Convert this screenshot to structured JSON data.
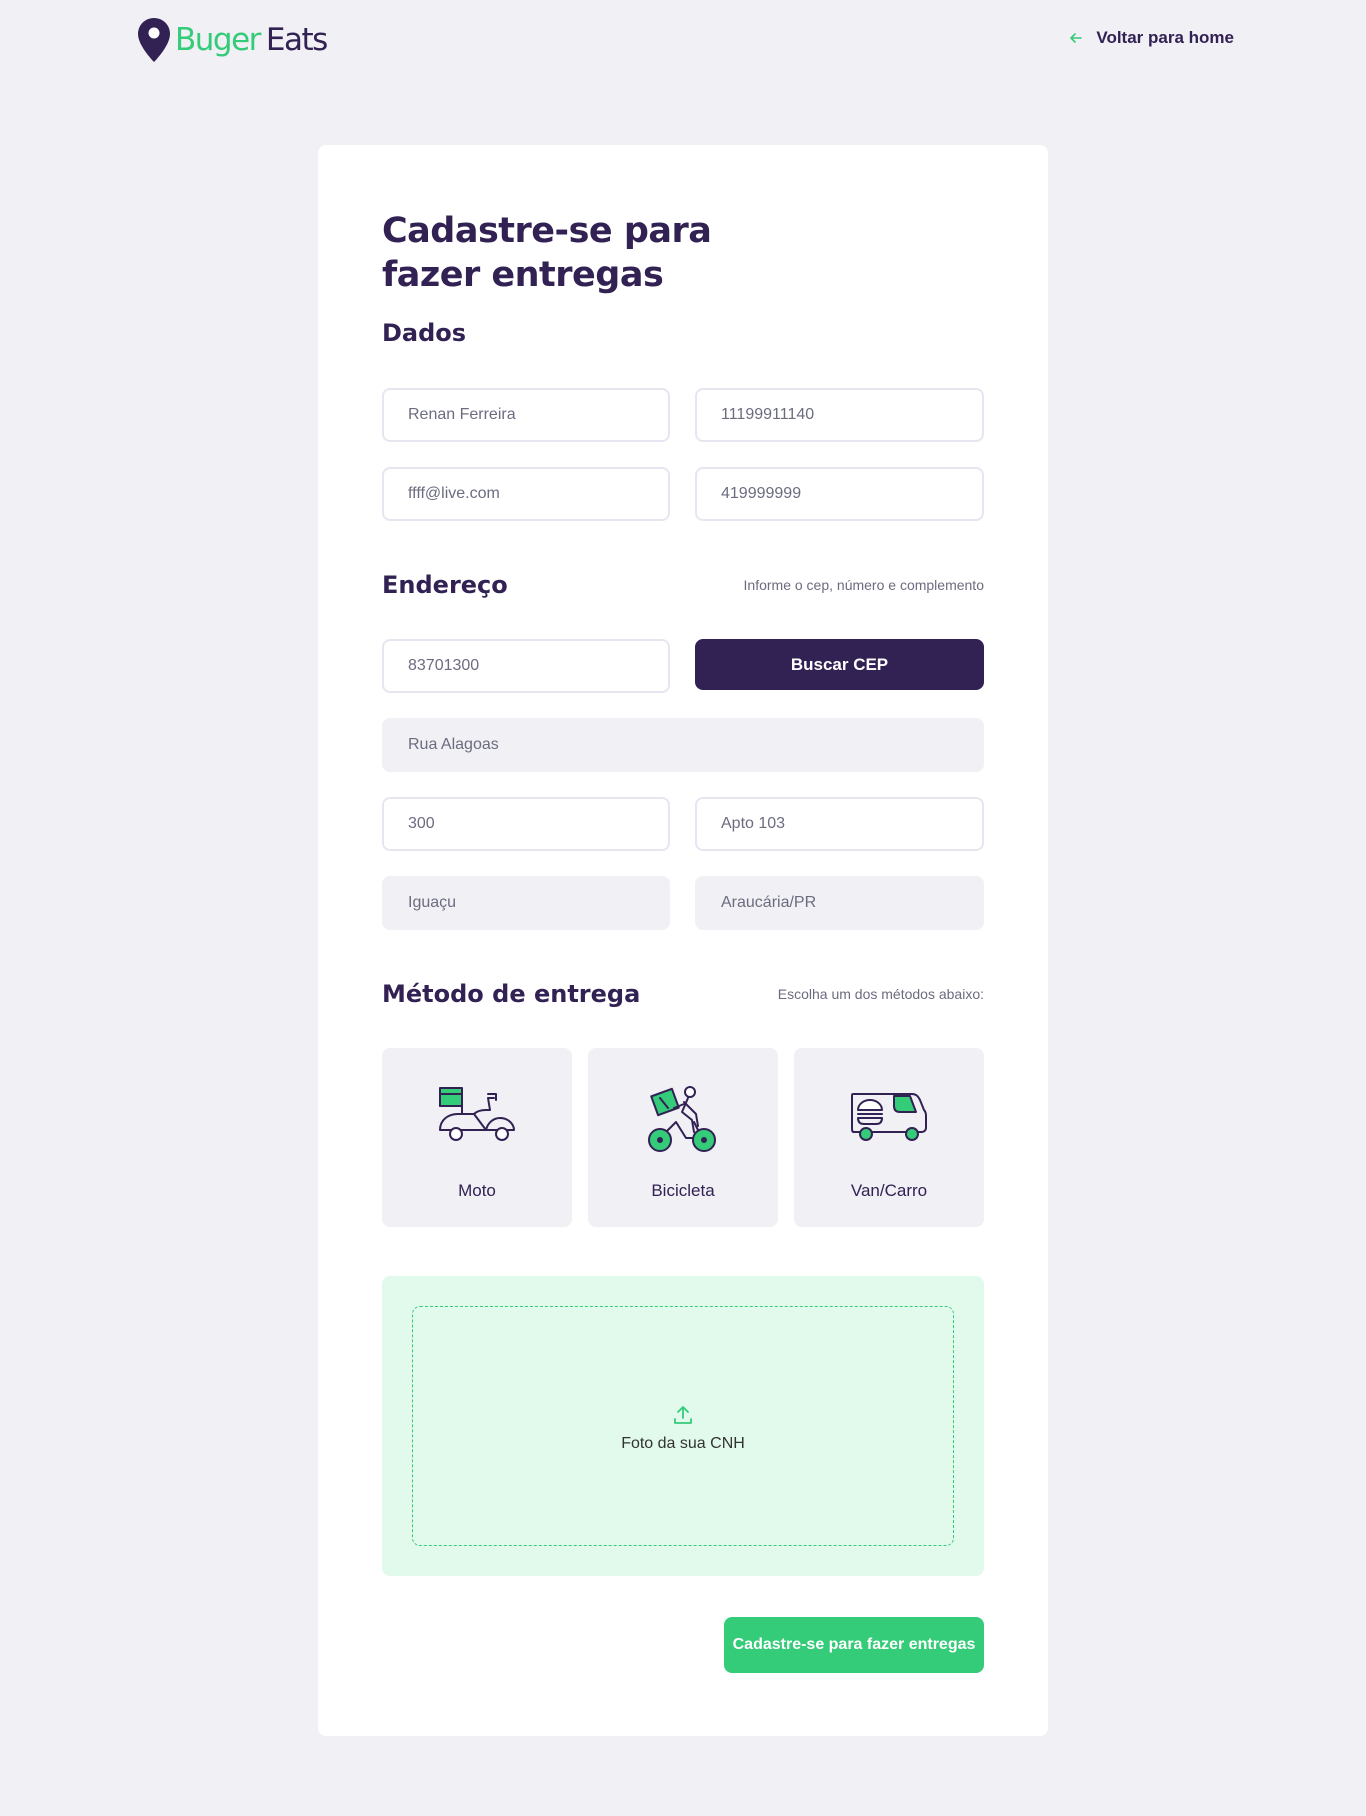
{
  "header": {
    "logo": {
      "part1": "Bug",
      "part2": "er",
      "part3": "Eats"
    },
    "back_link": "Voltar para home"
  },
  "form": {
    "title": "Cadastre-se para fazer entregas",
    "dados": {
      "title": "Dados",
      "nome": "Renan Ferreira",
      "cpf": "11199911140",
      "email": "ffff@live.com",
      "whatsapp": "419999999"
    },
    "endereco": {
      "title": "Endereço",
      "hint": "Informe o cep, número e complemento",
      "cep": "83701300",
      "buscar_cep": "Buscar CEP",
      "rua": "Rua Alagoas",
      "numero": "300",
      "complemento": "Apto 103",
      "bairro": "Iguaçu",
      "cidade_uf": "Araucária/PR"
    },
    "metodo": {
      "title": "Método de entrega",
      "hint": "Escolha um dos métodos abaixo:",
      "options": [
        {
          "label": "Moto",
          "icon": "scooter-icon"
        },
        {
          "label": "Bicicleta",
          "icon": "bicycle-icon"
        },
        {
          "label": "Van/Carro",
          "icon": "van-icon"
        }
      ]
    },
    "upload": {
      "label": "Foto da sua CNH",
      "icon": "upload-icon"
    },
    "submit": "Cadastre-se para fazer entregas"
  },
  "colors": {
    "primary": "#322153",
    "accent": "#34cb79",
    "background": "#f0f0f5",
    "dropzone": "#e1faec",
    "muted_text": "#6c6c80"
  }
}
